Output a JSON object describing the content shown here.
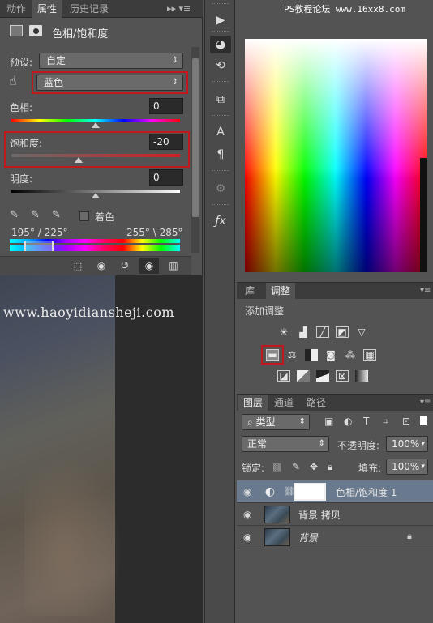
{
  "panel_tabs": [
    "动作",
    "属性",
    "历史记录"
  ],
  "panel_menu_glyph": "▸▸ ▾≡",
  "properties": {
    "title": "色相/饱和度",
    "preset_label": "预设:",
    "preset_value": "自定",
    "channel_value": "蓝色",
    "hue_label": "色相:",
    "hue_value": "0",
    "saturation_label": "饱和度:",
    "saturation_value": "-20",
    "lightness_label": "明度:",
    "lightness_value": "0",
    "colorize_label": "着色",
    "range_left": "195° / 225°",
    "range_right": "255° \\ 285°",
    "hue_level": 0.5,
    "saturation_level": 0.4,
    "lightness_level": 0.5
  },
  "watermark_left": "www.haoyidiansheji.com",
  "watermark_top": "PS教程论坛 www.16xx8.com",
  "adjustments": {
    "tabs": [
      "库",
      "调整"
    ],
    "title": "添加调整",
    "icons_row1": [
      "brightness-icon",
      "levels-icon",
      "curves-icon",
      "exposure-icon",
      "vibrance-icon"
    ],
    "icons_row2": [
      "hue-saturation-icon",
      "color-balance-icon",
      "black-white-icon",
      "photo-filter-icon",
      "channel-mixer-icon",
      "color-lookup-icon"
    ],
    "icons_row3": [
      "invert-icon",
      "posterize-icon",
      "threshold-icon",
      "selective-color-icon",
      "gradient-map-icon"
    ]
  },
  "layers": {
    "tabs": [
      "图层",
      "通道",
      "路径"
    ],
    "filter_value": "类型",
    "blend_mode": "正常",
    "opacity_label": "不透明度:",
    "opacity_value": "100%",
    "lock_label": "锁定:",
    "fill_label": "填充:",
    "fill_value": "100%",
    "items": [
      {
        "name": "色相/饱和度 1"
      },
      {
        "name": "背景 拷贝"
      },
      {
        "name": "背景"
      }
    ]
  },
  "colors": {
    "highlight": "#c0181c",
    "selected_layer": "#6a7a8e"
  }
}
